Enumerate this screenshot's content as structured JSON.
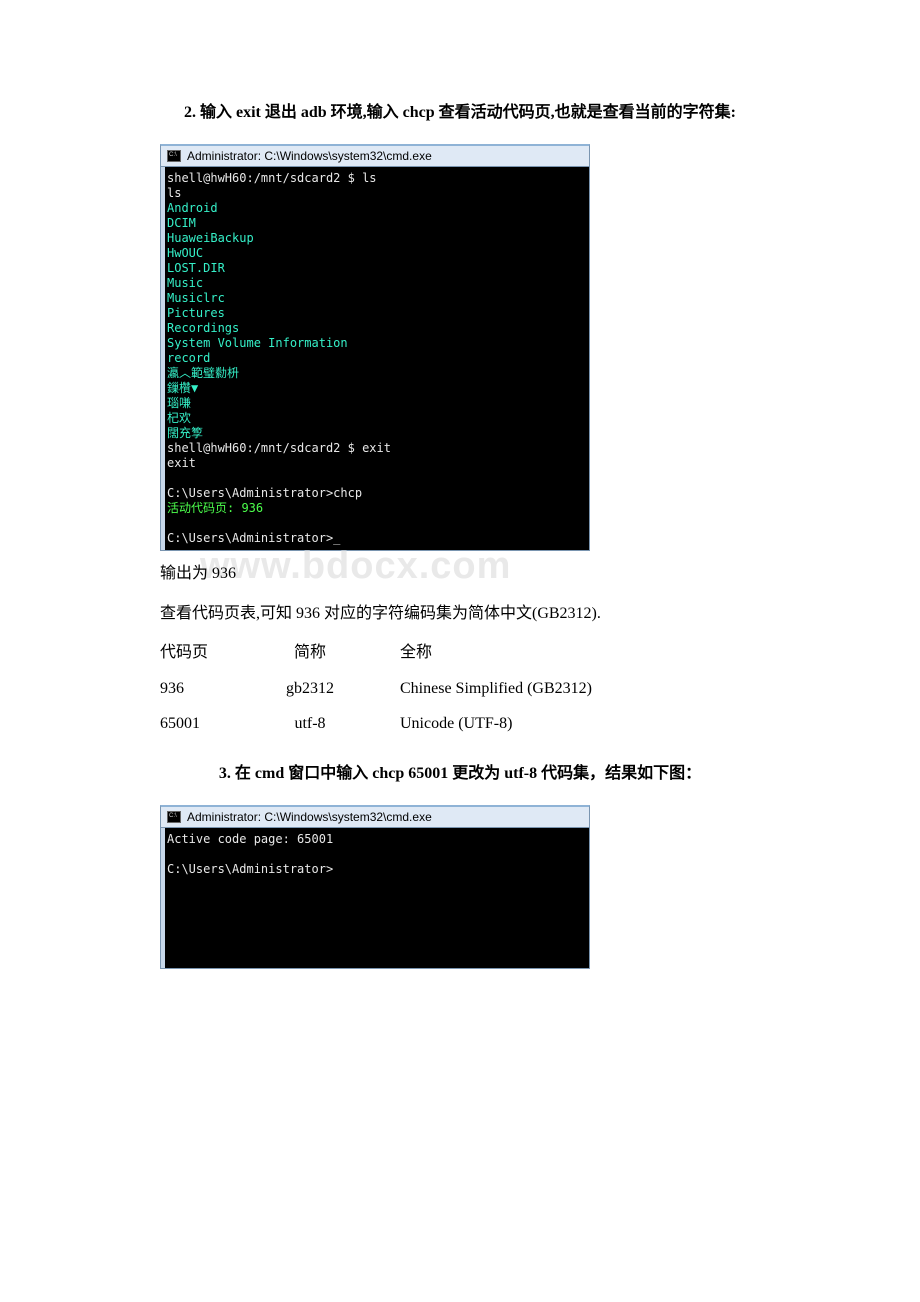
{
  "section2": {
    "heading": "2. 输入 exit 退出 adb 环境,输入 chcp 查看活动代码页,也就是查看当前的字符集:"
  },
  "cmd1": {
    "title": "Administrator: C:\\Windows\\system32\\cmd.exe",
    "lines": [
      {
        "cls": "c-white",
        "text": "shell@hwH60:/mnt/sdcard2 $ ls"
      },
      {
        "cls": "c-white",
        "text": "ls"
      },
      {
        "cls": "c-cyan",
        "text": "Android"
      },
      {
        "cls": "c-cyan",
        "text": "DCIM"
      },
      {
        "cls": "c-cyan",
        "text": "HuaweiBackup"
      },
      {
        "cls": "c-cyan",
        "text": "HwOUC"
      },
      {
        "cls": "c-cyan",
        "text": "LOST.DIR"
      },
      {
        "cls": "c-cyan",
        "text": "Music"
      },
      {
        "cls": "c-cyan",
        "text": "Musiclrc"
      },
      {
        "cls": "c-cyan",
        "text": "Pictures"
      },
      {
        "cls": "c-cyan",
        "text": "Recordings"
      },
      {
        "cls": "c-cyan",
        "text": "System Volume Information"
      },
      {
        "cls": "c-cyan",
        "text": "record"
      },
      {
        "cls": "c-cyan",
        "text": "瀛︿範璧勬枡"
      },
      {
        "cls": "c-cyan",
        "text": "鏁欑▼"
      },
      {
        "cls": "c-cyan",
        "text": "瑙嗛"
      },
      {
        "cls": "c-cyan",
        "text": "杞欢"
      },
      {
        "cls": "c-cyan",
        "text": "闊充箰"
      },
      {
        "cls": "c-white",
        "text": "shell@hwH60:/mnt/sdcard2 $ exit"
      },
      {
        "cls": "c-white",
        "text": "exit"
      },
      {
        "cls": "c-white",
        "text": " "
      },
      {
        "cls": "c-white",
        "text": "C:\\Users\\Administrator>chcp"
      },
      {
        "cls": "c-green",
        "text": "活动代码页: 936"
      },
      {
        "cls": "c-white",
        "text": " "
      },
      {
        "cls": "c-white",
        "text": "C:\\Users\\Administrator>_"
      }
    ]
  },
  "watermark_text": "www.bdocx.com",
  "output_line": "输出为 936",
  "explain_line": "查看代码页表,可知 936 对应的字符编码集为简体中文(GB2312).",
  "table": {
    "header": {
      "c1": "代码页",
      "c2": "简称",
      "c3": "全称"
    },
    "rows": [
      {
        "c1": "936",
        "c2": "gb2312",
        "c3": "Chinese Simplified (GB2312)"
      },
      {
        "c1": "65001",
        "c2": "utf-8",
        "c3": "Unicode (UTF-8)"
      }
    ]
  },
  "section3": {
    "heading": "3. 在 cmd 窗口中输入 chcp 65001 更改为 utf-8 代码集，结果如下图："
  },
  "cmd2": {
    "title": "Administrator: C:\\Windows\\system32\\cmd.exe",
    "lines": [
      {
        "cls": "c-white",
        "text": "Active code page: 65001"
      },
      {
        "cls": "c-white",
        "text": " "
      },
      {
        "cls": "c-white",
        "text": "C:\\Users\\Administrator>"
      }
    ]
  }
}
